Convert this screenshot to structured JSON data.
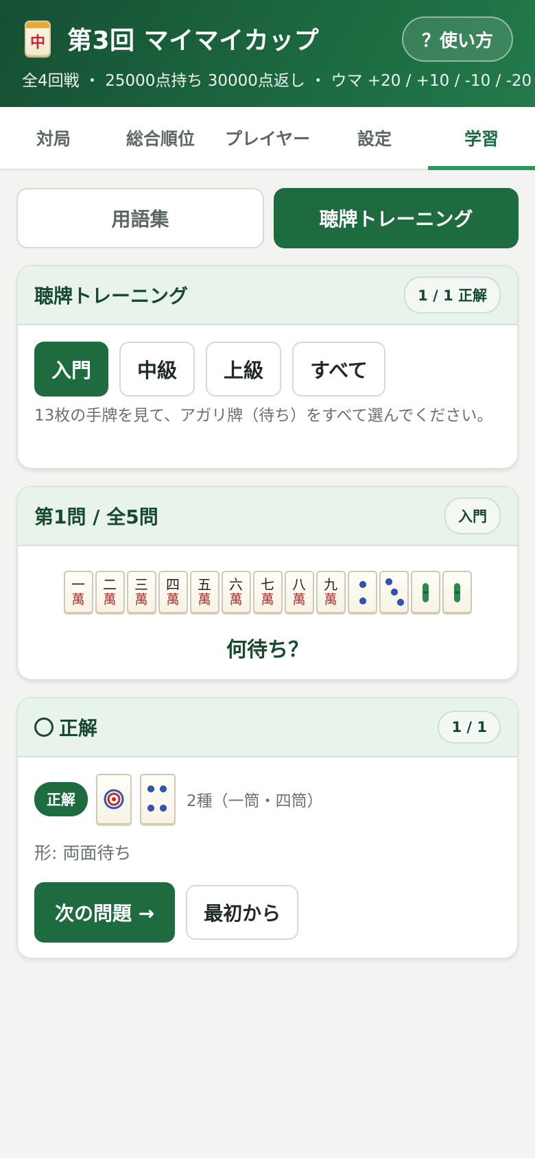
{
  "header": {
    "icon_glyph": "中",
    "title": "第3回 マイマイカップ",
    "help_button": "？使い方",
    "subtitle": "全4回戦 ・ 25000点持ち 30000点返し ・ ウマ +20 / +10 / -10 / -20"
  },
  "tabs": [
    {
      "label": "対局"
    },
    {
      "label": "総合順位"
    },
    {
      "label": "プレイヤー"
    },
    {
      "label": "設定"
    },
    {
      "label": "学習",
      "active": true
    }
  ],
  "subtabs": {
    "glossary": "用語集",
    "training": "聴牌トレーニング"
  },
  "training_card": {
    "title": "聴牌トレーニング",
    "score": "1 / 1 正解",
    "levels": [
      "入門",
      "中級",
      "上級",
      "すべて"
    ],
    "selected_level": "入門",
    "description": "13枚の手牌を見て、アガリ牌（待ち）をすべて選んでください。"
  },
  "question_card": {
    "title": "第1問 / 全5問",
    "level_badge": "入門",
    "hand": [
      {
        "num": "一",
        "suit": "萬"
      },
      {
        "num": "二",
        "suit": "萬"
      },
      {
        "num": "三",
        "suit": "萬"
      },
      {
        "num": "四",
        "suit": "萬"
      },
      {
        "num": "五",
        "suit": "萬"
      },
      {
        "num": "六",
        "suit": "萬"
      },
      {
        "num": "七",
        "suit": "萬"
      },
      {
        "num": "八",
        "suit": "萬"
      },
      {
        "num": "九",
        "suit": "萬"
      },
      {
        "tile": "2-pin-icon"
      },
      {
        "tile": "3-pin-icon"
      },
      {
        "tile": "2-sou-icon"
      },
      {
        "tile": "2-sou-icon"
      }
    ],
    "prompt": "何待ち？"
  },
  "result_card": {
    "title": "正解",
    "count": "1 / 1",
    "badge": "正解",
    "wait_tiles": [
      "1-pin-icon",
      "4-pin-icon"
    ],
    "wait_text": "2種（一筒・四筒）",
    "shape": "形: 両面待ち",
    "next_button": "次の問題 →",
    "restart_button": "最初から"
  },
  "colors": {
    "primary": "#1e6b40",
    "header_dark": "#164f33",
    "accent_underline": "#2a9a5a",
    "man_red": "#c62828",
    "pin_blue": "#2f55b8",
    "sou_green": "#2a8a4d"
  }
}
